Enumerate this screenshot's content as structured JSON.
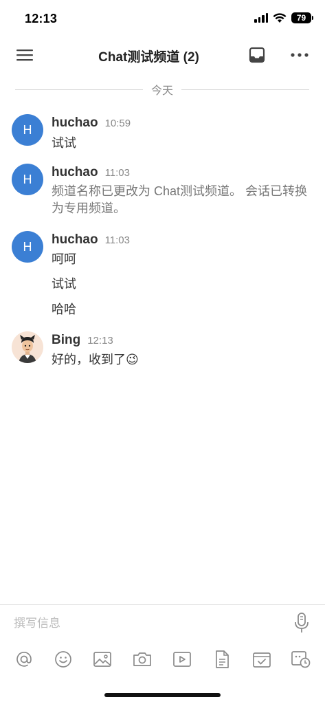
{
  "status_bar": {
    "time": "12:13",
    "battery": "79"
  },
  "header": {
    "title": "Chat测试频道 (2)"
  },
  "date_divider": "今天",
  "messages": [
    {
      "sender": "huchao",
      "avatar_initial": "H",
      "time": "10:59",
      "lines": [
        "试试"
      ]
    },
    {
      "sender": "huchao",
      "avatar_initial": "H",
      "time": "11:03",
      "lines": [
        "频道名称已更改为 Chat测试频道。 会话已转换为专用频道。"
      ],
      "system": true
    },
    {
      "sender": "huchao",
      "avatar_initial": "H",
      "time": "11:03",
      "lines": [
        "呵呵",
        "试试",
        "哈哈"
      ]
    },
    {
      "sender": "Bing",
      "avatar_initial": "",
      "time": "12:13",
      "lines": [
        "好的，收到了😉"
      ]
    }
  ],
  "composer": {
    "placeholder": "撰写信息"
  },
  "icons": {
    "menu": "hamburger-menu-icon",
    "inbox": "inbox-icon",
    "more": "more-options-icon",
    "mic": "microphone-icon",
    "toolbar": [
      "at-mention-icon",
      "emoji-icon",
      "image-icon",
      "camera-icon",
      "video-icon",
      "file-icon",
      "task-icon",
      "schedule-icon"
    ]
  },
  "colors": {
    "avatar": "#3b7fd4",
    "icon_gray": "#8a8a8a",
    "text": "#333333"
  }
}
